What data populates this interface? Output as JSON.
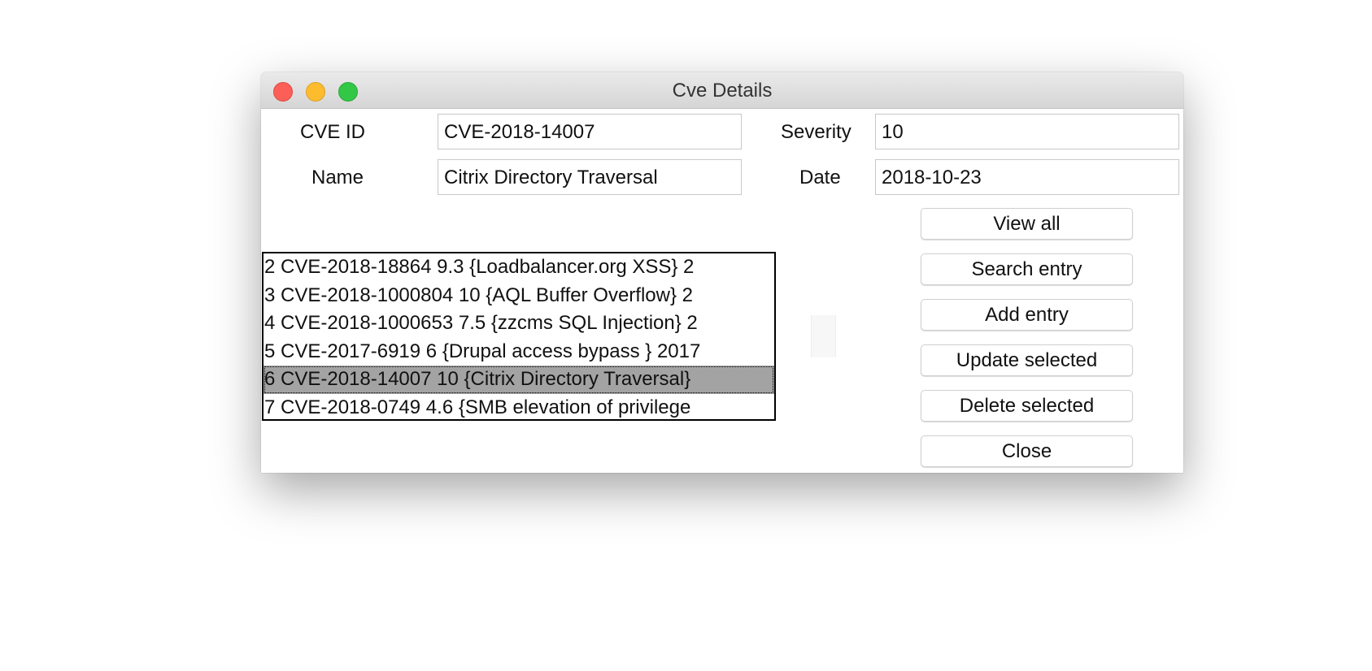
{
  "window": {
    "title": "Cve Details"
  },
  "form": {
    "cve_id_label": "CVE ID",
    "cve_id_value": "CVE-2018-14007",
    "name_label": "Name",
    "name_value": "Citrix Directory Traversal",
    "severity_label": "Severity",
    "severity_value": "10",
    "date_label": "Date",
    "date_value": "2018-10-23"
  },
  "list": {
    "rows": [
      "2 CVE-2018-18864 9.3 {Loadbalancer.org XSS} 2",
      "3 CVE-2018-1000804 10 {AQL Buffer Overflow} 2",
      "4 CVE-2018-1000653 7.5 {zzcms SQL Injection} 2",
      "5 CVE-2017-6919 6 {Drupal access bypass } 2017",
      "6 CVE-2018-14007 10 {Citrix Directory Traversal}",
      "7 CVE-2018-0749 4.6 {SMB elevation of privilege"
    ],
    "selected_index": 4
  },
  "buttons": {
    "view_all": "View all",
    "search": "Search entry",
    "add": "Add entry",
    "update": "Update selected",
    "delete": "Delete selected",
    "close": "Close"
  }
}
